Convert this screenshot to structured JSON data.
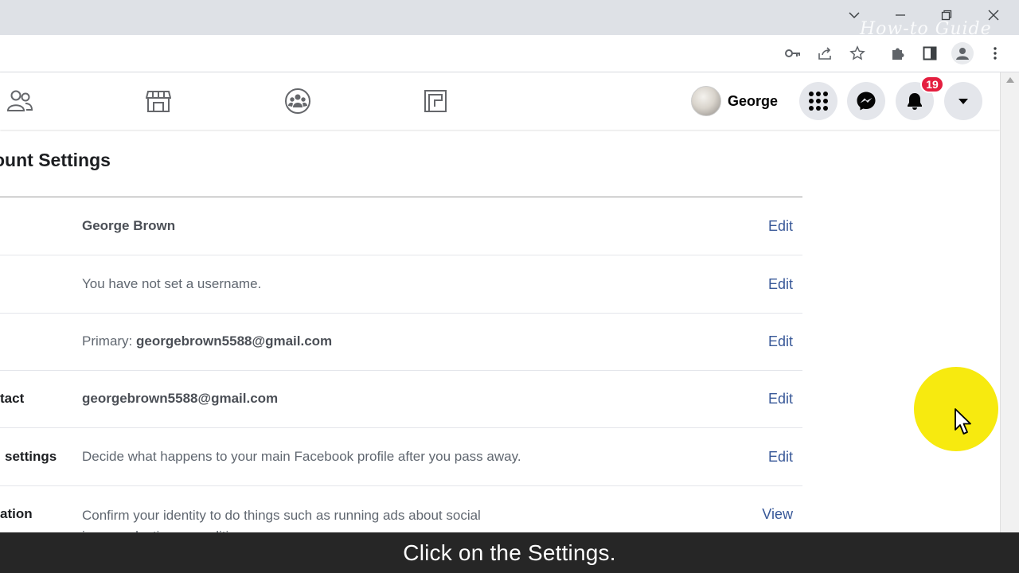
{
  "browser": {
    "watermark": "How-to Guide"
  },
  "facebook": {
    "profile_name": "George",
    "notification_count": "19"
  },
  "settings": {
    "heading": "ount Settings",
    "rows": [
      {
        "label": "",
        "value": "George Brown",
        "value_bold": "",
        "action": "Edit"
      },
      {
        "label": "",
        "value": "You have not set a username.",
        "value_bold": "",
        "action": "Edit"
      },
      {
        "label": "",
        "value": "Primary: ",
        "value_bold": "georgebrown5588@gmail.com",
        "action": "Edit"
      },
      {
        "label": "tact",
        "value": "georgebrown5588@gmail.com",
        "value_bold": "",
        "action": "Edit"
      },
      {
        "label": "settings",
        "value": "Decide what happens to your main Facebook profile after you pass away.",
        "value_bold": "",
        "action": "Edit"
      },
      {
        "label": "ation",
        "value": "Confirm your identity to do things such as running ads about social",
        "value_line2": "issues, elections or politics.",
        "value_bold": "",
        "action": "View"
      }
    ]
  },
  "caption": "Click on the Settings.",
  "colors": {
    "link": "#385898",
    "badge": "#e41e3f",
    "cursor_highlight": "#f7ea0f"
  }
}
